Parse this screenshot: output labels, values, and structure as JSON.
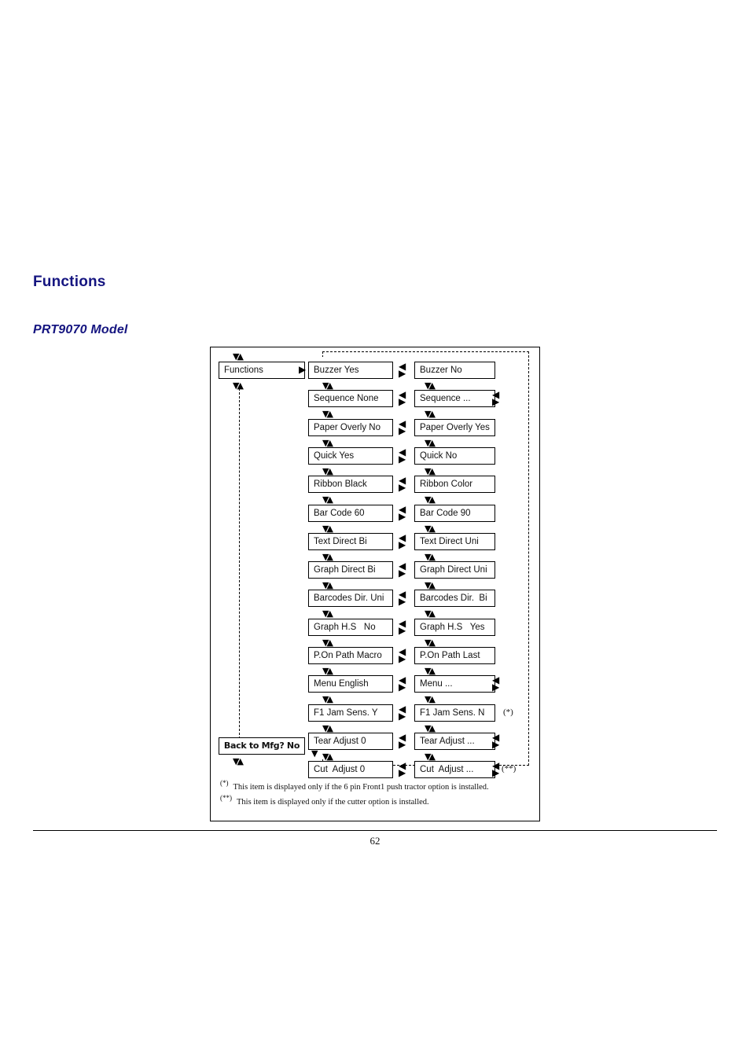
{
  "headings": {
    "section": "Functions",
    "model": "PRT9070 Model"
  },
  "diagram": {
    "root_box": "Functions",
    "return_box": "Back to Mfg? No",
    "rows": [
      {
        "left": "Buzzer Yes",
        "right": "Buzzer No",
        "right_submenu": false,
        "footnote": ""
      },
      {
        "left": "Sequence None",
        "right": "Sequence ...",
        "right_submenu": true,
        "footnote": ""
      },
      {
        "left": "Paper Overly No",
        "right": "Paper Overly Yes",
        "right_submenu": false,
        "footnote": ""
      },
      {
        "left": "Quick Yes",
        "right": "Quick No",
        "right_submenu": false,
        "footnote": ""
      },
      {
        "left": "Ribbon Black",
        "right": "Ribbon Color",
        "right_submenu": false,
        "footnote": ""
      },
      {
        "left": "Bar Code 60",
        "right": "Bar Code 90",
        "right_submenu": false,
        "footnote": ""
      },
      {
        "left": "Text Direct Bi",
        "right": "Text Direct Uni",
        "right_submenu": false,
        "footnote": ""
      },
      {
        "left": "Graph Direct Bi",
        "right": "Graph Direct Uni",
        "right_submenu": false,
        "footnote": ""
      },
      {
        "left": "Barcodes Dir. Uni",
        "right": "Barcodes Dir.  Bi",
        "right_submenu": false,
        "footnote": ""
      },
      {
        "left": "Graph H.S   No",
        "right": "Graph H.S   Yes",
        "right_submenu": false,
        "footnote": ""
      },
      {
        "left": "P.On Path Macro",
        "right": "P.On Path Last",
        "right_submenu": false,
        "footnote": ""
      },
      {
        "left": "Menu English",
        "right": "Menu ...",
        "right_submenu": true,
        "footnote": ""
      },
      {
        "left": "F1 Jam Sens. Y",
        "right": "F1 Jam Sens. N",
        "right_submenu": false,
        "footnote": "(*)"
      },
      {
        "left": "Tear Adjust 0",
        "right": "Tear Adjust ...",
        "right_submenu": true,
        "footnote": ""
      },
      {
        "left": "Cut  Adjust 0",
        "right": "Cut  Adjust ...",
        "right_submenu": true,
        "footnote": "(**)"
      }
    ],
    "footnotes": [
      {
        "marker": "(*)",
        "text": "This item is displayed only if the 6 pin Front1 push tractor option is installed."
      },
      {
        "marker": "(**)",
        "text": "This item is displayed only if the cutter option is installed."
      }
    ]
  },
  "footer": {
    "page_number": "62"
  },
  "icons": {
    "updown_arrow": "▼▲",
    "right_arrow": "▶",
    "down_arrow": "▼",
    "left_arrow": "◀"
  },
  "colors": {
    "heading": "#151580",
    "text": "#111111",
    "rule": "#000000"
  }
}
